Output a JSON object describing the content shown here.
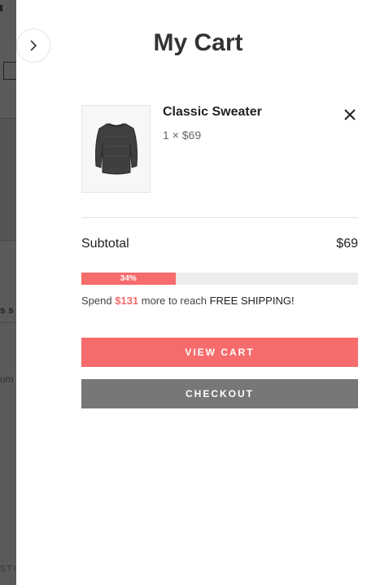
{
  "background": {
    "text_fragments": [
      "s s",
      "um",
      "STI"
    ]
  },
  "cart": {
    "title": "My Cart",
    "item": {
      "name": "Classic Sweater",
      "qty_price": "1 × $69",
      "image_icon": "sweater-image"
    },
    "subtotal_label": "Subtotal",
    "subtotal_value": "$69",
    "progress": {
      "percent": 34,
      "label": "34%"
    },
    "shipping": {
      "prefix": "Spend ",
      "amount": "$131",
      "middle": " more to reach ",
      "free": "FREE SHIPPING!"
    },
    "view_cart_label": "VIEW CART",
    "checkout_label": "CHECKOUT"
  },
  "colors": {
    "accent": "#f66b6b",
    "checkout": "#777777"
  }
}
